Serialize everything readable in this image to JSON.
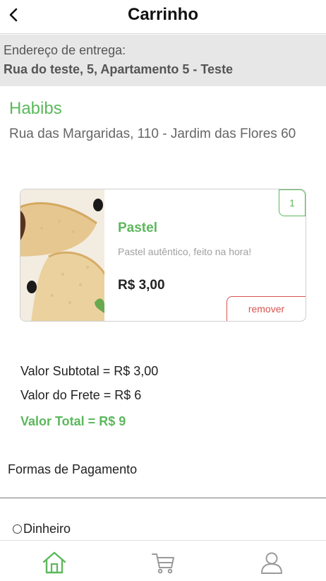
{
  "header": {
    "title": "Carrinho",
    "back_icon": "chevron-left-icon"
  },
  "delivery": {
    "label": "Endereço de entrega:",
    "address": "Rua do teste, 5, Apartamento 5 - Teste"
  },
  "store": {
    "name": "Habibs",
    "address": "Rua das Margaridas, 110 - Jardim das Flores 60"
  },
  "cart_items": [
    {
      "quantity": "1",
      "name": "Pastel",
      "description": "Pastel autêntico, feito na hora!",
      "price": "R$ 3,00",
      "remove_label": "remover"
    }
  ],
  "totals": {
    "subtotal": "Valor Subtotal = R$ 3,00",
    "shipping": "Valor do Frete = R$ 6",
    "total": "Valor Total = R$ 9"
  },
  "payment": {
    "title": "Formas de Pagamento",
    "options": [
      "Dinheiro"
    ]
  },
  "nav": {
    "items": [
      "home-icon",
      "cart-icon",
      "user-icon"
    ],
    "active": "home-icon"
  },
  "colors": {
    "accent": "#5cb85c",
    "danger": "#d9534f",
    "address_bg": "#e7e7e7",
    "nav_inactive": "#9a9a9a"
  }
}
